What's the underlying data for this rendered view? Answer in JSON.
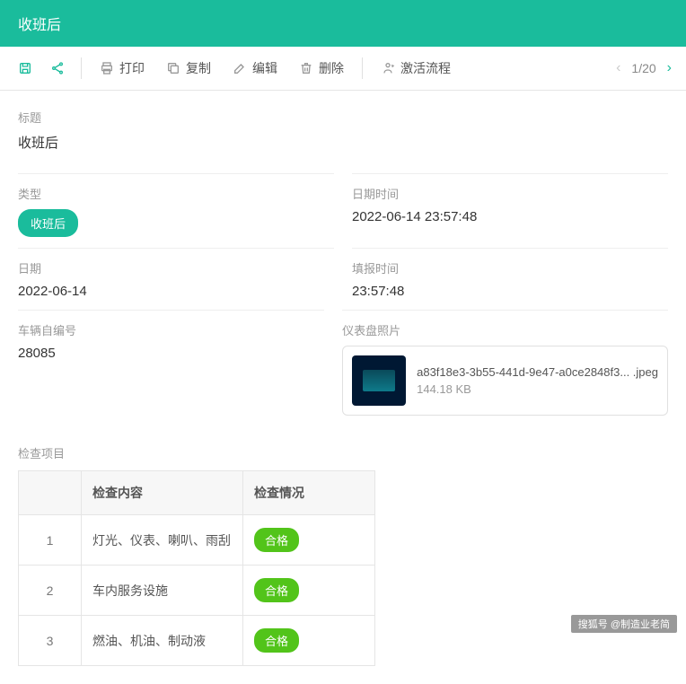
{
  "header": {
    "title": "收班后"
  },
  "toolbar": {
    "print": "打印",
    "copy": "复制",
    "edit": "编辑",
    "delete": "删除",
    "activate": "激活流程"
  },
  "pagination": {
    "current": "1",
    "sep": "/",
    "total": "20"
  },
  "fields": {
    "title_label": "标题",
    "title_value": "收班后",
    "type_label": "类型",
    "type_badge": "收班后",
    "datetime_label": "日期时间",
    "datetime_value": "2022-06-14 23:57:48",
    "date_label": "日期",
    "date_value": "2022-06-14",
    "report_time_label": "填报时间",
    "report_time_value": "23:57:48",
    "vehicle_no_label": "车辆自编号",
    "vehicle_no_value": "28085",
    "photo_label": "仪表盘照片",
    "file": {
      "name": "a83f18e3-3b55-441d-9e47-a0ce2848f3... .jpeg",
      "size": "144.18 KB"
    }
  },
  "checklist": {
    "title": "检查项目",
    "headers": {
      "content": "检查内容",
      "status": "检查情况"
    },
    "rows": [
      {
        "idx": "1",
        "content": "灯光、仪表、喇叭、雨刮",
        "status": "合格"
      },
      {
        "idx": "2",
        "content": "车内服务设施",
        "status": "合格"
      },
      {
        "idx": "3",
        "content": "燃油、机油、制动液",
        "status": "合格"
      }
    ]
  },
  "watermark": "搜狐号 @制造业老简"
}
